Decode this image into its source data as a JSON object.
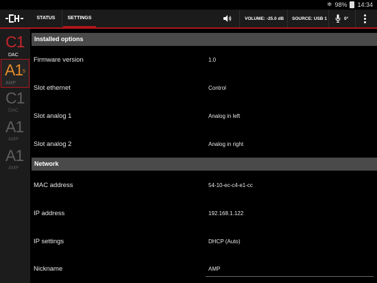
{
  "statusbar": {
    "battery": "98%",
    "time": "14:34"
  },
  "appbar": {
    "tabs": [
      {
        "label": "STATUS"
      },
      {
        "label": "SETTINGS"
      }
    ],
    "volume": "VOLUME: -25.0 dB",
    "source": "SOURCE: USB 1",
    "angle": "0°"
  },
  "sidebar": {
    "slots": [
      {
        "code": "C1",
        "type": "DAC"
      },
      {
        "code": "A1",
        "number": "5",
        "type": "AMP"
      },
      {
        "code": "C1",
        "type": "DAC"
      },
      {
        "code": "A1",
        "type": "AMP"
      },
      {
        "code": "A1",
        "type": "AMP"
      }
    ]
  },
  "sections": [
    {
      "title": "Installed options",
      "rows": [
        {
          "label": "Firmware version",
          "value": "1.0"
        },
        {
          "label": "Slot ethernet",
          "value": "Control"
        },
        {
          "label": "Slot analog 1",
          "value": "Analog in left"
        },
        {
          "label": "Slot analog 2",
          "value": "Analog in right"
        }
      ]
    },
    {
      "title": "Network",
      "rows": [
        {
          "label": "MAC address",
          "value": "54-10-ec-c4-e1-cc"
        },
        {
          "label": "IP address",
          "value": "192.168.1.122"
        },
        {
          "label": "IP settings",
          "value": "DHCP (Auto)"
        },
        {
          "label": "Nickname",
          "value": "AMP"
        }
      ]
    }
  ],
  "colors": {
    "accent": "#b2161d",
    "amber": "#e58a2a",
    "section_bg": "#4a4a4a",
    "sidebar_bg": "#1c1c1c"
  }
}
